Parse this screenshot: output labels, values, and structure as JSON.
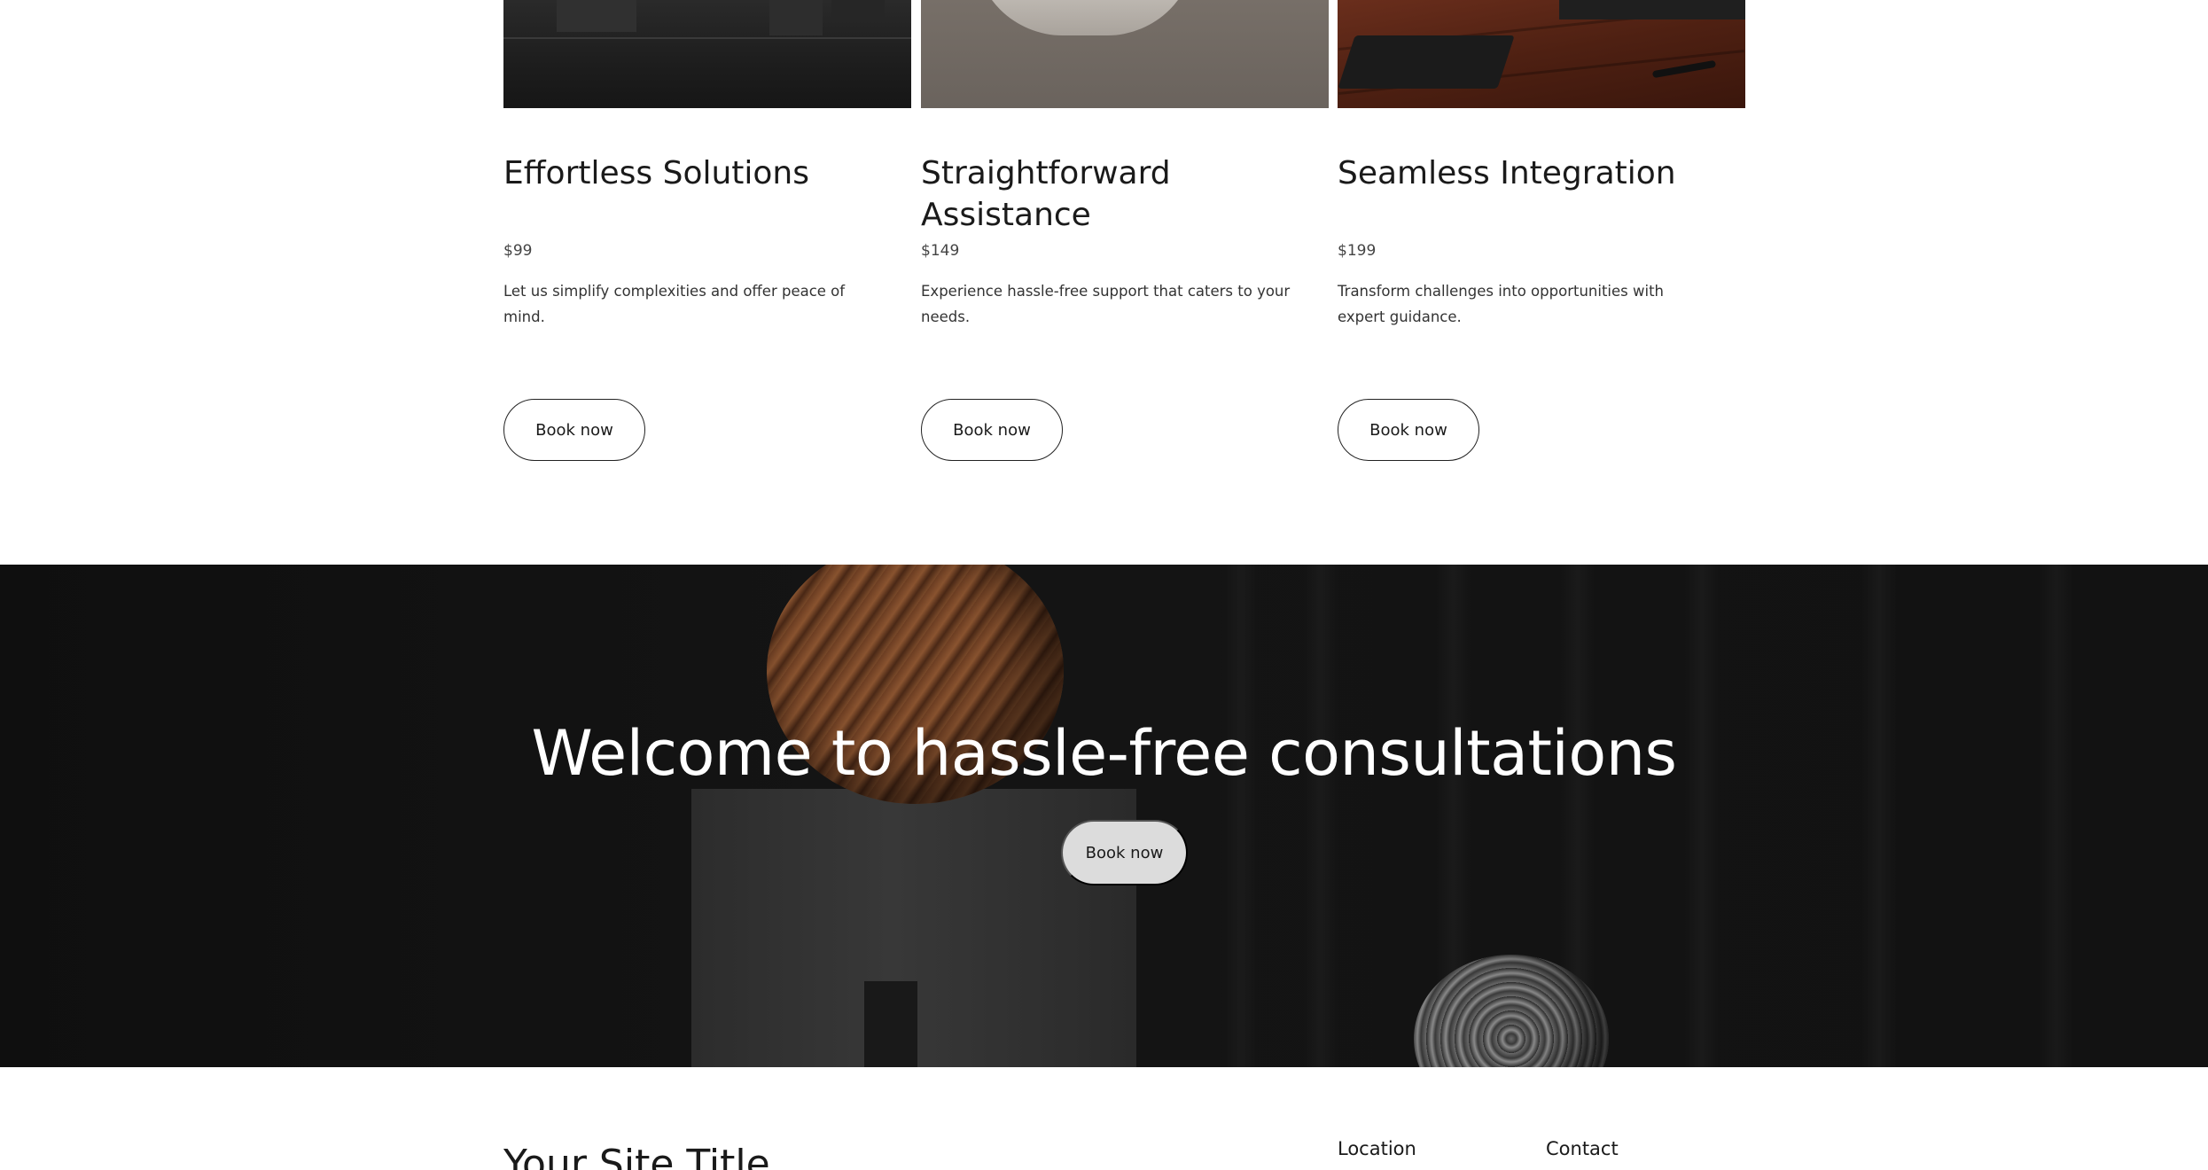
{
  "services": {
    "cards": [
      {
        "title": "Effortless Solutions",
        "price": "$99",
        "description": "Let us simplify complexities and offer peace of mind.",
        "button": "Book now"
      },
      {
        "title": "Straightforward Assistance",
        "price": "$149",
        "description": "Experience hassle-free support that caters to your needs.",
        "button": "Book now"
      },
      {
        "title": "Seamless Integration",
        "price": "$199",
        "description": "Transform challenges into opportunities with expert guidance.",
        "button": "Book now"
      }
    ]
  },
  "banner": {
    "heading": "Welcome to hassle-free consultations",
    "button": "Book now"
  },
  "footer": {
    "site_title": "Your Site Title",
    "location_heading": "Location",
    "contact_heading": "Contact"
  },
  "colors": {
    "banner_background": "#121212",
    "solid_button": "#dcdcdc",
    "text": "#1a1a1a"
  }
}
